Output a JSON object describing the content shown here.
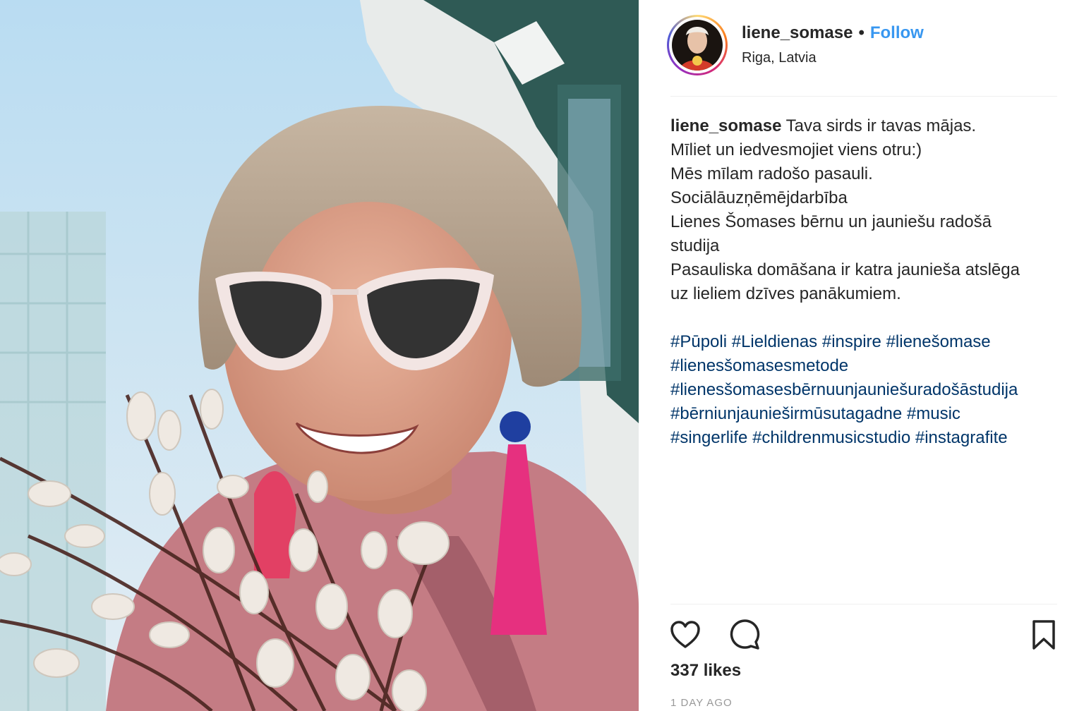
{
  "account": {
    "username": "liene_somase",
    "separator": "•",
    "follow_label": "Follow",
    "location": "Riga, Latvia"
  },
  "caption": {
    "username": "liene_somase",
    "lines": [
      "Tava sirds ir tavas mājas.",
      "Mīliet un iedvesmojiet viens otru:)",
      "Mēs mīlam radošo pasauli.",
      "Sociālāuzņēmējdarbība",
      "Lienes Šomases bērnu un jauniešu radošā",
      "studija",
      "Pasauliska domāšana ir katra jaunieša atslēga",
      "uz lieliem dzīves panākumiem."
    ],
    "hashtag_lines": [
      [
        "#Pūpoli",
        "#Lieldienas",
        "#inspire",
        "#lienešomase"
      ],
      [
        "#lienesšomasesmetode"
      ],
      [
        "#lienesšomasesbērnuunjauniešuradošāstudija"
      ],
      [
        "#bērniunjaunieširmūsutagadne",
        "#music"
      ],
      [
        "#singerlife",
        "#childrenmusicstudio",
        "#instagrafite"
      ]
    ]
  },
  "actions": {
    "like_icon": "heart-icon",
    "comment_icon": "comment-icon",
    "save_icon": "bookmark-icon"
  },
  "likes": "337 likes",
  "time": "1 DAY AGO",
  "colors": {
    "link": "#3897f0",
    "hashtag": "#003569",
    "text": "#262626",
    "muted": "#999999"
  }
}
